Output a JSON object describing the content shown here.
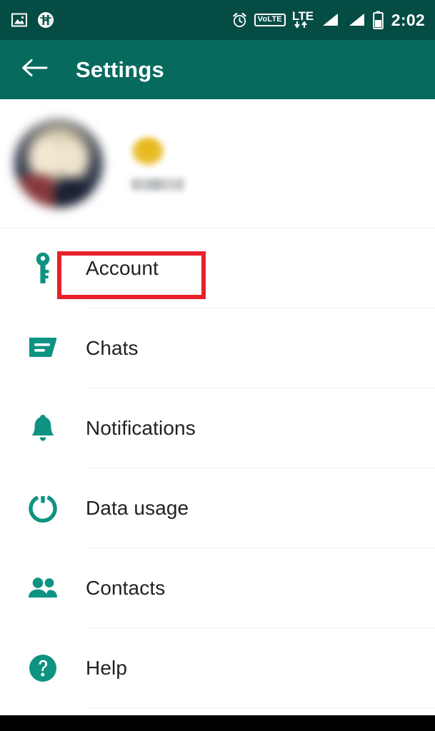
{
  "status_bar": {
    "icons_left": [
      "screenshot-image-icon",
      "app-badge-h-icon"
    ],
    "icons_right": [
      "alarm-clock-icon",
      "volte-badge",
      "lte-data-icon",
      "signal-sim1-icon",
      "signal-sim2-icon",
      "battery-icon"
    ],
    "volte_label": "VoLTE",
    "lte_label": "LTE",
    "time": "2:02",
    "background_color": "#054C44"
  },
  "app_bar": {
    "back_icon": "arrow-left-icon",
    "title": "Settings",
    "background_color": "#076A5E",
    "text_color": "#FFFFFF"
  },
  "profile": {
    "avatar": "user-avatar-blurred",
    "emoji": "blurred-emoji",
    "name": "",
    "blurred": true
  },
  "settings_list": {
    "icon_color": "#0E9382",
    "items": [
      {
        "label": "Account",
        "icon": "key-icon",
        "highlighted": true
      },
      {
        "label": "Chats",
        "icon": "chat-bubble-icon",
        "highlighted": false
      },
      {
        "label": "Notifications",
        "icon": "bell-icon",
        "highlighted": false
      },
      {
        "label": "Data usage",
        "icon": "data-usage-circle-icon",
        "highlighted": false
      },
      {
        "label": "Contacts",
        "icon": "contacts-people-icon",
        "highlighted": false
      },
      {
        "label": "Help",
        "icon": "help-question-icon",
        "highlighted": false
      }
    ]
  },
  "annotation": {
    "target": "Account",
    "color": "#E8212B",
    "shape": "rectangle"
  },
  "nav_bar": {
    "background_color": "#000000"
  }
}
